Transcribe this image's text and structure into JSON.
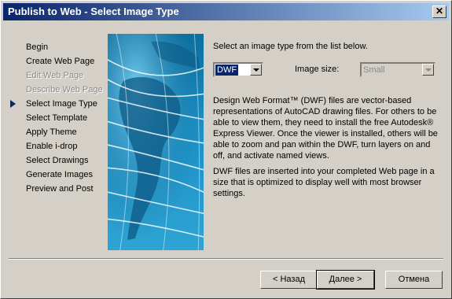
{
  "window": {
    "title": "Publish to Web - Select Image Type",
    "close_glyph": "✕"
  },
  "nav": {
    "items": [
      {
        "label": "Begin",
        "state": "normal"
      },
      {
        "label": "Create Web Page",
        "state": "normal"
      },
      {
        "label": "Edit Web Page",
        "state": "disabled"
      },
      {
        "label": "Describe Web Page",
        "state": "disabled"
      },
      {
        "label": "Select Image Type",
        "state": "current"
      },
      {
        "label": "Select Template",
        "state": "normal"
      },
      {
        "label": "Apply Theme",
        "state": "normal"
      },
      {
        "label": "Enable i-drop",
        "state": "normal"
      },
      {
        "label": "Select Drawings",
        "state": "normal"
      },
      {
        "label": "Generate Images",
        "state": "normal"
      },
      {
        "label": "Preview and Post",
        "state": "normal"
      }
    ]
  },
  "content": {
    "instruction": "Select an image type from the list below.",
    "image_type": {
      "value": "DWF"
    },
    "image_size": {
      "label": "Image size:",
      "value": "Small",
      "enabled": false
    },
    "description": "Design Web Format™ (DWF) files are vector-based representations of AutoCAD drawing files.  For others to be able to view them, they need to install the free Autodesk® Express Viewer.  Once the viewer is installed, others will be able to zoom and pan within the DWF, turn layers on and off, and activate named views.",
    "note": "DWF files are inserted into your completed Web page in a size that is optimized to display well with most browser settings."
  },
  "buttons": {
    "back": "< Назад",
    "next": "Далее >",
    "cancel": "Отмена"
  },
  "colors": {
    "title_bar": "#0a246a",
    "dialog_face": "#d4d0c8",
    "current_step_arrow": "#0a246a"
  }
}
